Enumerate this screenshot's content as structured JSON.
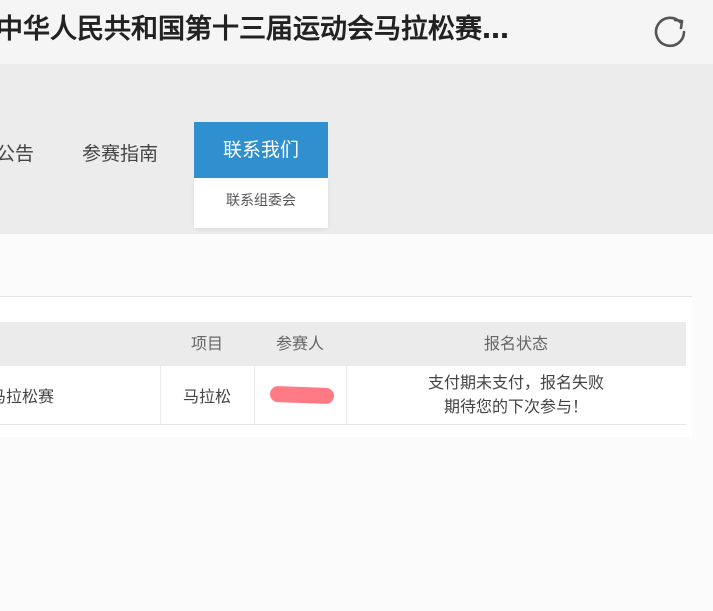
{
  "header": {
    "title": "中华人民共和国第十三届运动会马拉松赛…",
    "refresh_icon": "refresh-icon"
  },
  "nav": {
    "items": [
      {
        "label": "公告"
      },
      {
        "label": "参赛指南"
      },
      {
        "label": "联系我们"
      }
    ],
    "active_index": 2,
    "dropdown": [
      "联系组委会"
    ],
    "accent_color": "#2f8fcf"
  },
  "table": {
    "headers": [
      "项目",
      "参赛人",
      "报名状态"
    ],
    "rows": [
      {
        "event": "马拉松赛",
        "project": "马拉松",
        "participant": "",
        "status_line1": "支付期未支付，报名失败",
        "status_line2": "期待您的下次参与！"
      }
    ]
  }
}
